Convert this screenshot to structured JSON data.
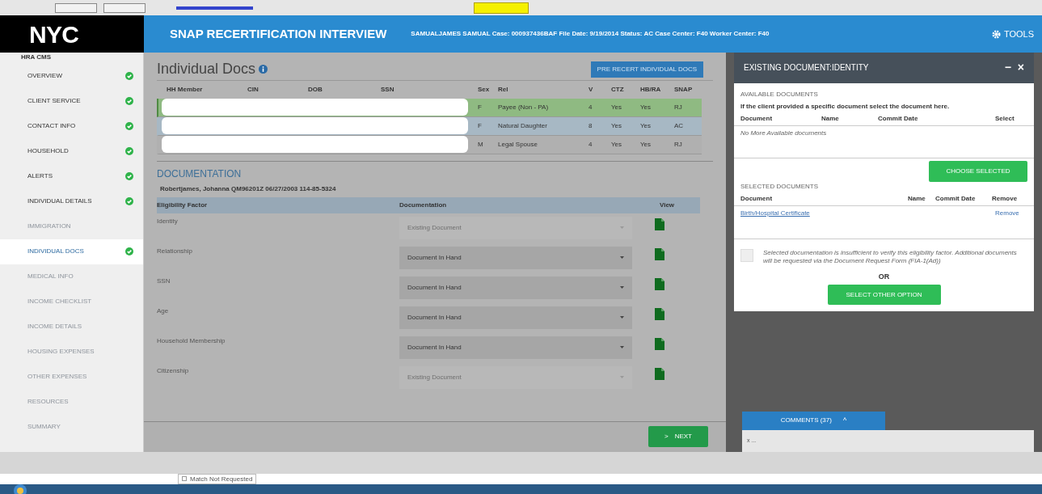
{
  "header": {
    "logo": "NYC",
    "title": "SNAP RECERTIFICATION INTERVIEW",
    "case_info": "SAMUALJAMES SAMUAL  Case: 000937436BAF  File Date: 9/19/2014  Status: AC  Case Center: F40  Worker Center: F40",
    "tools": "TOOLS"
  },
  "sidebar": {
    "brand": "HRA CMS",
    "items": [
      {
        "label": "OVERVIEW",
        "done": true,
        "disabled": false,
        "selected": false
      },
      {
        "label": "CLIENT SERVICE",
        "done": true,
        "disabled": false,
        "selected": false
      },
      {
        "label": "CONTACT INFO",
        "done": true,
        "disabled": false,
        "selected": false
      },
      {
        "label": "HOUSEHOLD",
        "done": true,
        "disabled": false,
        "selected": false
      },
      {
        "label": "ALERTS",
        "done": true,
        "disabled": false,
        "selected": false
      },
      {
        "label": "INDIVIDUAL DETAILS",
        "done": true,
        "disabled": false,
        "selected": false
      },
      {
        "label": "IMMIGRATION",
        "done": false,
        "disabled": true,
        "selected": false
      },
      {
        "label": "INDIVIDUAL DOCS",
        "done": true,
        "disabled": false,
        "selected": true
      },
      {
        "label": "MEDICAL INFO",
        "done": false,
        "disabled": true,
        "selected": false
      },
      {
        "label": "INCOME CHECKLIST",
        "done": false,
        "disabled": true,
        "selected": false
      },
      {
        "label": "INCOME DETAILS",
        "done": false,
        "disabled": true,
        "selected": false
      },
      {
        "label": "HOUSING EXPENSES",
        "done": false,
        "disabled": true,
        "selected": false
      },
      {
        "label": "OTHER EXPENSES",
        "done": false,
        "disabled": true,
        "selected": false
      },
      {
        "label": "RESOURCES",
        "done": false,
        "disabled": true,
        "selected": false
      },
      {
        "label": "SUMMARY",
        "done": false,
        "disabled": true,
        "selected": false
      }
    ]
  },
  "main": {
    "title": "Individual Docs",
    "pre_recert_button": "PRE RECERT INDIVIDUAL DOCS",
    "members": {
      "columns": [
        "HH Member",
        "CIN",
        "DOB",
        "SSN",
        "Sex",
        "Rel",
        "V",
        "CTZ",
        "HB/RA",
        "SNAP"
      ],
      "rows": [
        {
          "sex": "F",
          "rel": "Payee (Non - PA)",
          "v": "4",
          "ctz": "Yes",
          "hbra": "Yes",
          "snap": "RJ",
          "selected": true,
          "highlighted": false
        },
        {
          "sex": "F",
          "rel": "Natural Daughter",
          "v": "8",
          "ctz": "Yes",
          "hbra": "Yes",
          "snap": "AC",
          "selected": false,
          "highlighted": true
        },
        {
          "sex": "M",
          "rel": "Legal Spouse",
          "v": "4",
          "ctz": "Yes",
          "hbra": "Yes",
          "snap": "RJ",
          "selected": false,
          "highlighted": false
        }
      ]
    },
    "documentation": {
      "heading": "DOCUMENTATION",
      "person": "Robertjames, Johanna QM96201Z 06/27/2003 114-85-5324",
      "columns": [
        "Eligibility Factor",
        "Documentation",
        "View"
      ],
      "rows": [
        {
          "factor": "Identity",
          "value": "Existing Document",
          "disabled": true
        },
        {
          "factor": "Relationship",
          "value": "Document In Hand",
          "disabled": false
        },
        {
          "factor": "SSN",
          "value": "Document In Hand",
          "disabled": false
        },
        {
          "factor": "Age",
          "value": "Document In Hand",
          "disabled": false
        },
        {
          "factor": "Household Membership",
          "value": "Document In Hand",
          "disabled": false
        },
        {
          "factor": "Citizenship",
          "value": "Existing Document",
          "disabled": true
        }
      ]
    },
    "next_button": "NEXT",
    "next_icon": ">"
  },
  "panel": {
    "title": "EXISTING DOCUMENT:IDENTITY",
    "minimize": "−",
    "close": "×",
    "available": {
      "heading": "AVAILABLE DOCUMENTS",
      "instruction": "If the client provided a specific document select the document here.",
      "columns": [
        "Document",
        "Name",
        "Commit Date",
        "Select"
      ],
      "empty": "No More Available documents"
    },
    "choose_button": "CHOOSE SELECTED",
    "selected": {
      "heading": "SELECTED DOCUMENTS",
      "columns": [
        "Document",
        "Name",
        "Commit Date",
        "Remove"
      ],
      "rows": [
        {
          "document": "Birth/Hospital Certificate",
          "remove": "Remove"
        }
      ]
    },
    "insufficient": {
      "checked": false,
      "text": "Selected documentation is insufficient to verify this eligibility factor. Additional documents will be requested via the Document Request Form (FIA-1(Ad))"
    },
    "or": "OR",
    "other_button": "SELECT OTHER OPTION"
  },
  "comments": {
    "tab": "COMMENTS (37)",
    "caret": "^",
    "preview": "x ..."
  },
  "footer": {
    "match_checked": false,
    "match_label": "Match Not Requested"
  }
}
